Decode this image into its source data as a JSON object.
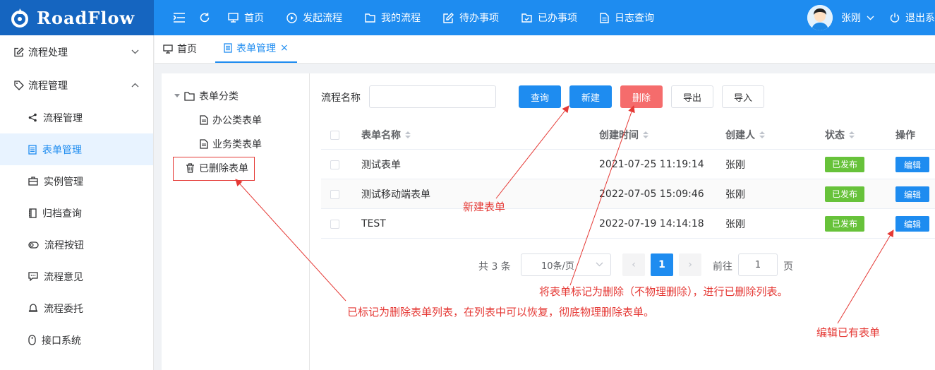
{
  "app": {
    "logo_text": "RoadFlow"
  },
  "topnav": {
    "items": [
      {
        "label": "首页",
        "icon": "monitor-icon"
      },
      {
        "label": "发起流程",
        "icon": "play-circle-icon"
      },
      {
        "label": "我的流程",
        "icon": "folder-icon"
      },
      {
        "label": "待办事项",
        "icon": "edit-icon"
      },
      {
        "label": "已办事项",
        "icon": "folder-check-icon"
      },
      {
        "label": "日志查询",
        "icon": "document-icon"
      }
    ],
    "user_name": "张刚",
    "logout_label": "退出系"
  },
  "sidebar": {
    "group1": "流程处理",
    "group2": "流程管理",
    "items": [
      {
        "label": "流程管理",
        "icon": "share-icon"
      },
      {
        "label": "表单管理",
        "icon": "form-icon"
      },
      {
        "label": "实例管理",
        "icon": "briefcase-icon"
      },
      {
        "label": "归档查询",
        "icon": "notebook-icon"
      },
      {
        "label": "流程按钮",
        "icon": "toggle-icon"
      },
      {
        "label": "流程意见",
        "icon": "chat-icon"
      },
      {
        "label": "流程委托",
        "icon": "bell-icon"
      },
      {
        "label": "接口系统",
        "icon": "mouse-icon"
      }
    ],
    "active_index": 1
  },
  "tabs": [
    {
      "label": "首页"
    },
    {
      "label": "表单管理",
      "close": "×"
    }
  ],
  "tree": {
    "root": "表单分类",
    "children": [
      "办公类表单",
      "业务类表单"
    ],
    "deleted": "已删除表单"
  },
  "filter": {
    "label": "流程名称",
    "value": "",
    "buttons": {
      "query": "查询",
      "new": "新建",
      "delete": "删除",
      "export": "导出",
      "import": "导入"
    }
  },
  "table": {
    "headers": [
      "表单名称",
      "创建时间",
      "创建人",
      "状态",
      "操作"
    ],
    "rows": [
      {
        "name": "测试表单",
        "time": "2021-07-25 11:19:14",
        "creator": "张刚",
        "status": "已发布",
        "action": "编辑"
      },
      {
        "name": "测试移动端表单",
        "time": "2022-07-05 15:09:46",
        "creator": "张刚",
        "status": "已发布",
        "action": "编辑"
      },
      {
        "name": "TEST",
        "time": "2022-07-19 14:14:18",
        "creator": "张刚",
        "status": "已发布",
        "action": "编辑"
      }
    ]
  },
  "pagination": {
    "total": "共 3 条",
    "page_size": "10条/页",
    "current": "1",
    "goto_label": "前往",
    "jump_value": "1",
    "page_label": "页",
    "prev": "‹",
    "next": "›"
  },
  "annotations": {
    "new_form": "新建表单",
    "mark_delete": "将表单标记为删除（不物理删除），进行已删除列表。",
    "deleted_list": "已标记为删除表单列表，在列表中可以恢复，彻底物理删除表单。",
    "edit_form": "编辑已有表单",
    "color": "#e53935"
  }
}
